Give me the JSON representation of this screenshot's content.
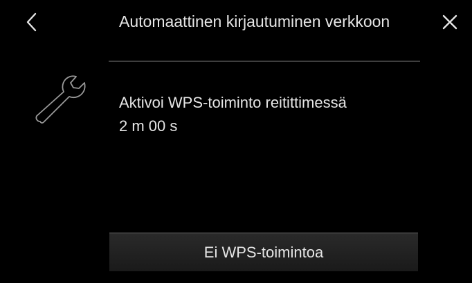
{
  "header": {
    "title": "Automaattinen kirjautuminen verkkoon",
    "back_icon": "chevron-left-icon",
    "close_icon": "close-icon"
  },
  "content": {
    "icon": "wrench-icon",
    "instruction": "Aktivoi WPS-toiminto reitittimessä",
    "countdown": "2 m 00 s"
  },
  "footer": {
    "button_label": "Ei WPS-toimintoa"
  }
}
